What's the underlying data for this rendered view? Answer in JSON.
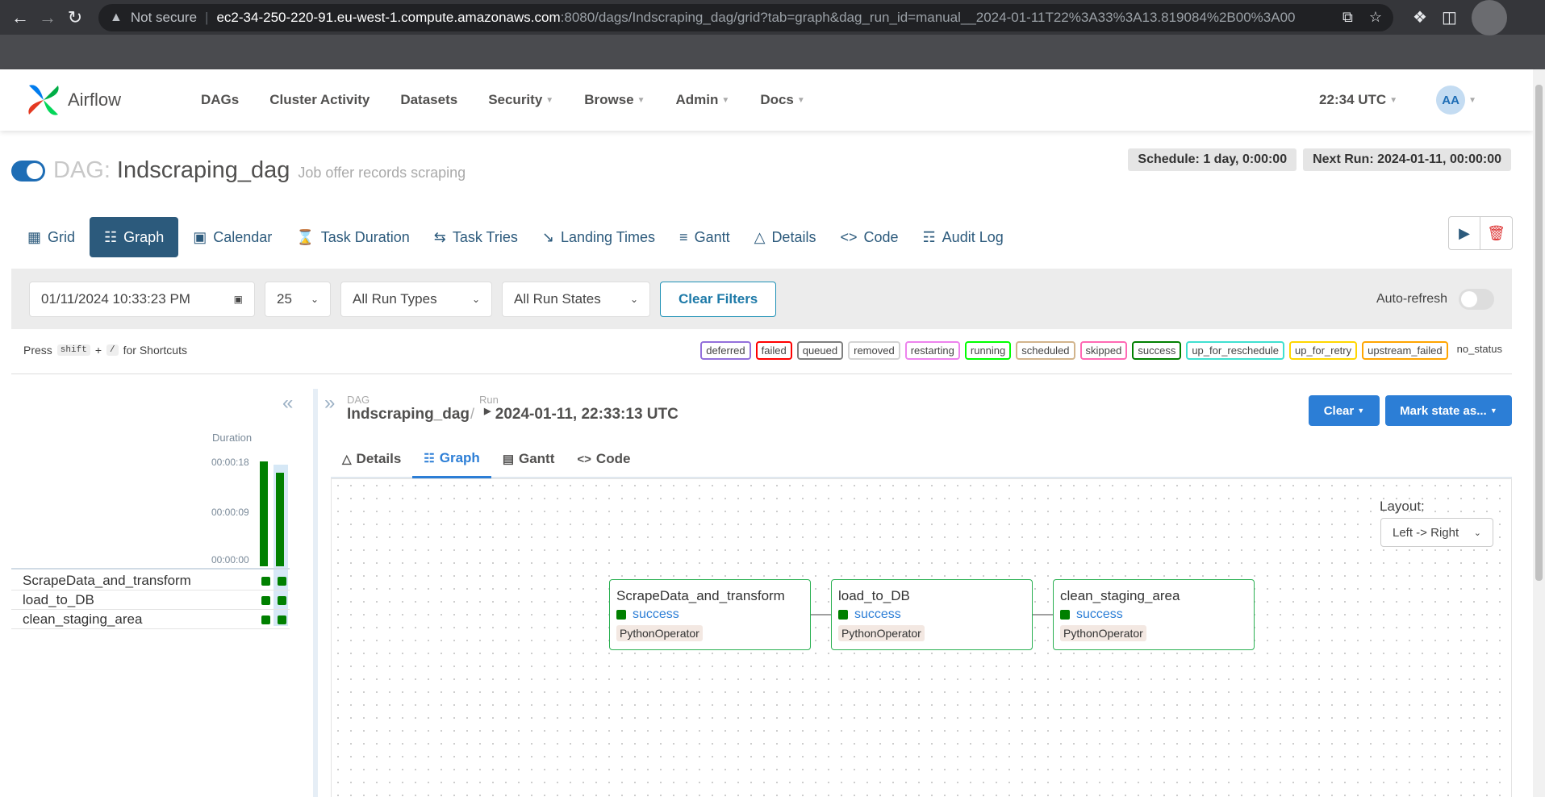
{
  "browser": {
    "security_label": "Not secure",
    "url_host": "ec2-34-250-220-91.eu-west-1.compute.amazonaws.com",
    "url_rest": ":8080/dags/Indscraping_dag/grid?tab=graph&dag_run_id=manual__2024-01-11T22%3A33%3A13.819084%2B00%3A00"
  },
  "navbar": {
    "brand": "Airflow",
    "items": [
      "DAGs",
      "Cluster Activity",
      "Datasets",
      "Security",
      "Browse",
      "Admin",
      "Docs"
    ],
    "clock": "22:34 UTC",
    "user_initials": "AA"
  },
  "dag": {
    "prefix": "DAG:",
    "name": "Indscraping_dag",
    "description": "Job offer records scraping",
    "schedule": "Schedule: 1 day, 0:00:00",
    "next_run": "Next Run: 2024-01-11, 00:00:00"
  },
  "view_tabs": [
    "Grid",
    "Graph",
    "Calendar",
    "Task Duration",
    "Task Tries",
    "Landing Times",
    "Gantt",
    "Details",
    "Code",
    "Audit Log"
  ],
  "filters": {
    "date": "01/11/2024 10:33:23 PM",
    "num_runs": "25",
    "run_types": "All Run Types",
    "run_states": "All Run States",
    "clear": "Clear Filters",
    "autorefresh": "Auto-refresh"
  },
  "shortcuts": {
    "press": "Press",
    "key1": "shift",
    "plus": "+",
    "key2": "/",
    "suffix": "for Shortcuts"
  },
  "legend": [
    {
      "label": "deferred",
      "color": "#9370db"
    },
    {
      "label": "failed",
      "color": "#ff0000"
    },
    {
      "label": "queued",
      "color": "#808080"
    },
    {
      "label": "removed",
      "color": "#d3d3d3"
    },
    {
      "label": "restarting",
      "color": "#ee82ee"
    },
    {
      "label": "running",
      "color": "#00ff00"
    },
    {
      "label": "scheduled",
      "color": "#d2b48c"
    },
    {
      "label": "skipped",
      "color": "#ff69b4"
    },
    {
      "label": "success",
      "color": "#008000"
    },
    {
      "label": "up_for_reschedule",
      "color": "#40e0d0"
    },
    {
      "label": "up_for_retry",
      "color": "#ffd700"
    },
    {
      "label": "upstream_failed",
      "color": "#ffa500"
    },
    {
      "label": "no_status",
      "color": ""
    }
  ],
  "grid": {
    "duration_label": "Duration",
    "ticks": [
      "00:00:18",
      "00:00:09",
      "00:00:00"
    ],
    "run_durations": [
      18,
      16
    ],
    "tasks": [
      "ScrapeData_and_transform",
      "load_to_DB",
      "clean_staging_area"
    ]
  },
  "details": {
    "dag_label": "DAG",
    "dag_value": "Indscraping_dag",
    "run_label": "Run",
    "run_value": "2024-01-11, 22:33:13 UTC",
    "clear_btn": "Clear",
    "mark_btn": "Mark state as...",
    "subtabs": [
      "Details",
      "Graph",
      "Gantt",
      "Code"
    ],
    "layout_label": "Layout:",
    "layout_value": "Left -> Right"
  },
  "graph_nodes": [
    {
      "name": "ScrapeData_and_transform",
      "state": "success",
      "operator": "PythonOperator"
    },
    {
      "name": "load_to_DB",
      "state": "success",
      "operator": "PythonOperator"
    },
    {
      "name": "clean_staging_area",
      "state": "success",
      "operator": "PythonOperator"
    }
  ]
}
